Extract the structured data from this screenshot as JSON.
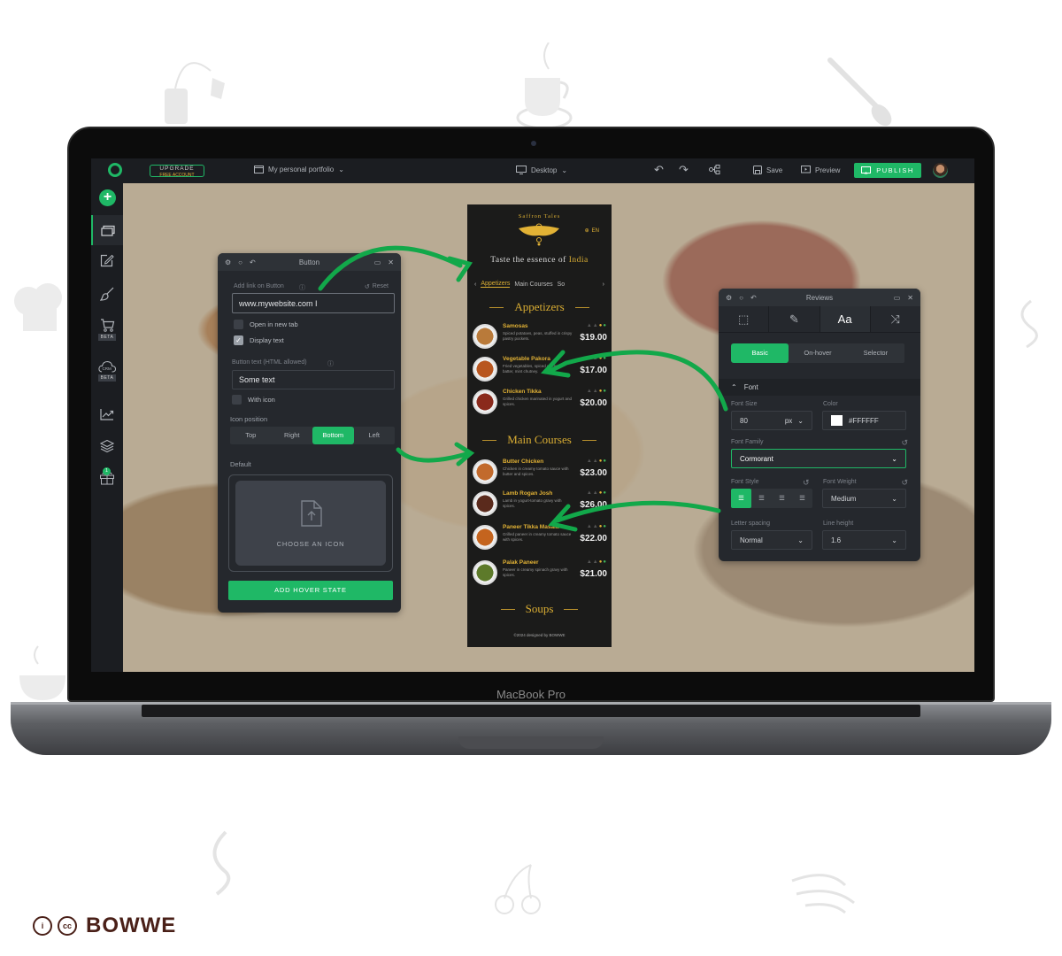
{
  "laptop": {
    "label": "MacBook Pro"
  },
  "topbar": {
    "upgrade_line1": "UPGRADE",
    "upgrade_line2": "FREE ACCOUNT",
    "project_name": "My personal portfolio",
    "device": "Desktop",
    "save_label": "Save",
    "preview_label": "Preview",
    "publish_label": "PUBLISH"
  },
  "sidebar": {
    "items": [
      {
        "icon": "add-icon"
      },
      {
        "icon": "pages-icon",
        "active": true
      },
      {
        "icon": "edit-icon"
      },
      {
        "icon": "brush-icon"
      },
      {
        "icon": "cart-icon",
        "badge": "BETA"
      },
      {
        "icon": "crm-cloud-icon",
        "badge": "BETA",
        "text": "CRM"
      },
      {
        "icon": "analytics-icon"
      },
      {
        "icon": "layers-icon"
      },
      {
        "icon": "gift-icon",
        "count": "1"
      }
    ]
  },
  "button_panel": {
    "title": "Button",
    "link_label": "Add link on Button",
    "reset_label": "Reset",
    "link_value": "www.mywebsite.com I",
    "open_new_tab_label": "Open in new tab",
    "open_new_tab_checked": false,
    "display_text_label": "Display text",
    "display_text_checked": true,
    "button_text_label": "Button text (HTML allowed)",
    "button_text_value": "Some text",
    "with_icon_label": "With icon",
    "with_icon_checked": false,
    "icon_position_label": "Icon position",
    "icon_positions": [
      "Top",
      "Right",
      "Bottom",
      "Left"
    ],
    "icon_position_selected": "Bottom",
    "default_label": "Default",
    "choose_icon_label": "CHOOSE AN ICON",
    "add_hover_label": "ADD HOVER STATE"
  },
  "menu_site": {
    "brand": "Saffron Tales",
    "lang": "EN",
    "tagline_pre": "Taste the essence of ",
    "tagline_accent": "India",
    "tabs": [
      "Appetizers",
      "Main Courses",
      "So"
    ],
    "active_tab": "Appetizers",
    "sections": [
      {
        "title": "Appetizers",
        "dishes": [
          {
            "name": "Samosas",
            "desc": "Spiced potatoes, peas, stuffed in crispy pastry pockets.",
            "price": "$19.00",
            "plate": "#b97a3a"
          },
          {
            "name": "Vegetable Pakora",
            "desc": "Fried vegetables, spiced chickpea batter, mint chutney.",
            "price": "$17.00",
            "plate": "#b8561f"
          },
          {
            "name": "Chicken Tikka",
            "desc": "Grilled chicken marinated in yogurt and spices.",
            "price": "$20.00",
            "plate": "#8a2a1c"
          }
        ]
      },
      {
        "title": "Main Courses",
        "dishes": [
          {
            "name": "Butter Chicken",
            "desc": "Chicken in creamy tomato sauce with butter and spices.",
            "price": "$23.00",
            "plate": "#c26a2c"
          },
          {
            "name": "Lamb Rogan Josh",
            "desc": "Lamb in yogurt-tomato gravy with spices.",
            "price": "$26.00",
            "plate": "#5a2a1c"
          },
          {
            "name": "Paneer Tikka Masala",
            "desc": "Grilled paneer in creamy tomato sauce with spices.",
            "price": "$22.00",
            "plate": "#c4641e"
          },
          {
            "name": "Palak Paneer",
            "desc": "Paneer in creamy spinach gravy with spices.",
            "price": "$21.00",
            "plate": "#5d7a2a"
          }
        ]
      },
      {
        "title": "Soups",
        "dishes": []
      }
    ],
    "footer": "©2024 designed by BOWWE"
  },
  "style_panel": {
    "title": "Reviews",
    "tabs": [
      "layout-icon",
      "brush-icon",
      "Aa",
      "shuffle-icon"
    ],
    "active_tab": "Aa",
    "states": [
      "Basic",
      "On-hover",
      "Selector"
    ],
    "active_state": "Basic",
    "section_label": "Font",
    "font_size_label": "Font Size",
    "font_size_value": "80",
    "font_size_unit": "px",
    "color_label": "Color",
    "color_value": "#FFFFFF",
    "font_family_label": "Font Family",
    "font_family_value": "Cormorant",
    "font_style_label": "Font Style",
    "alignments": [
      "align-left",
      "align-center",
      "align-right",
      "align-justify"
    ],
    "active_alignment": "align-left",
    "font_weight_label": "Font Weight",
    "font_weight_value": "Medium",
    "letter_spacing_label": "Letter spacing",
    "letter_spacing_value": "Normal",
    "line_height_label": "Line height",
    "line_height_value": "1.6"
  },
  "colors": {
    "accent": "#1FB866",
    "gold": "#D9AD33",
    "panel": "#25282D"
  },
  "footer_brand": {
    "license": "cc",
    "name": "BOWWE"
  }
}
